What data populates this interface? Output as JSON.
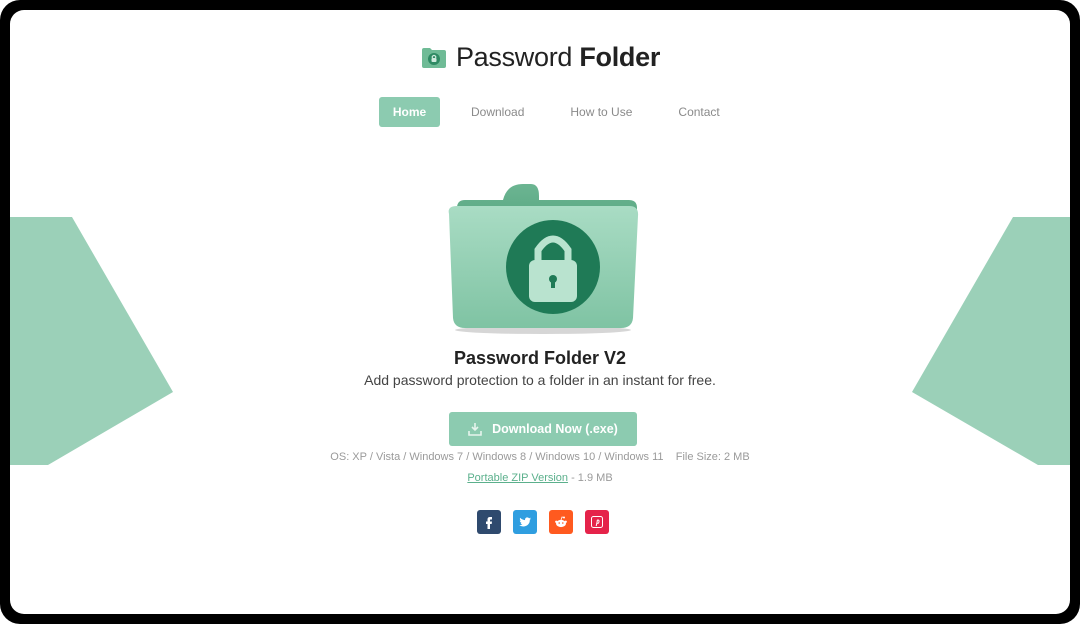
{
  "brand": {
    "name_light": "Password",
    "name_bold": "Folder",
    "accent": "#8ccbb0",
    "dark_green": "#2e8a63",
    "logo_icon": "folder-lock-icon"
  },
  "nav": {
    "items": [
      {
        "label": "Home",
        "active": true
      },
      {
        "label": "Download",
        "active": false
      },
      {
        "label": "How to Use",
        "active": false
      },
      {
        "label": "Contact",
        "active": false
      }
    ]
  },
  "hero": {
    "icon": "folder-lock-icon",
    "title": "Password Folder V2",
    "subtitle": "Add password protection to a folder in an instant for free."
  },
  "download": {
    "button_label": "Download Now (.exe)",
    "button_icon": "download-icon",
    "os_text": "OS: XP / Vista / Windows 7 / Windows 8 / Windows 10 / Windows 11",
    "file_size": "File Size: 2 MB",
    "portable_link": "Portable ZIP Version",
    "portable_size": " - 1.9 MB"
  },
  "social": [
    {
      "name": "facebook-icon",
      "color": "#2f4a6e"
    },
    {
      "name": "twitter-icon",
      "color": "#2f9ee0"
    },
    {
      "name": "reddit-icon",
      "color": "#ff5a1f"
    },
    {
      "name": "pinterest-icon",
      "color": "#e5234a"
    }
  ]
}
